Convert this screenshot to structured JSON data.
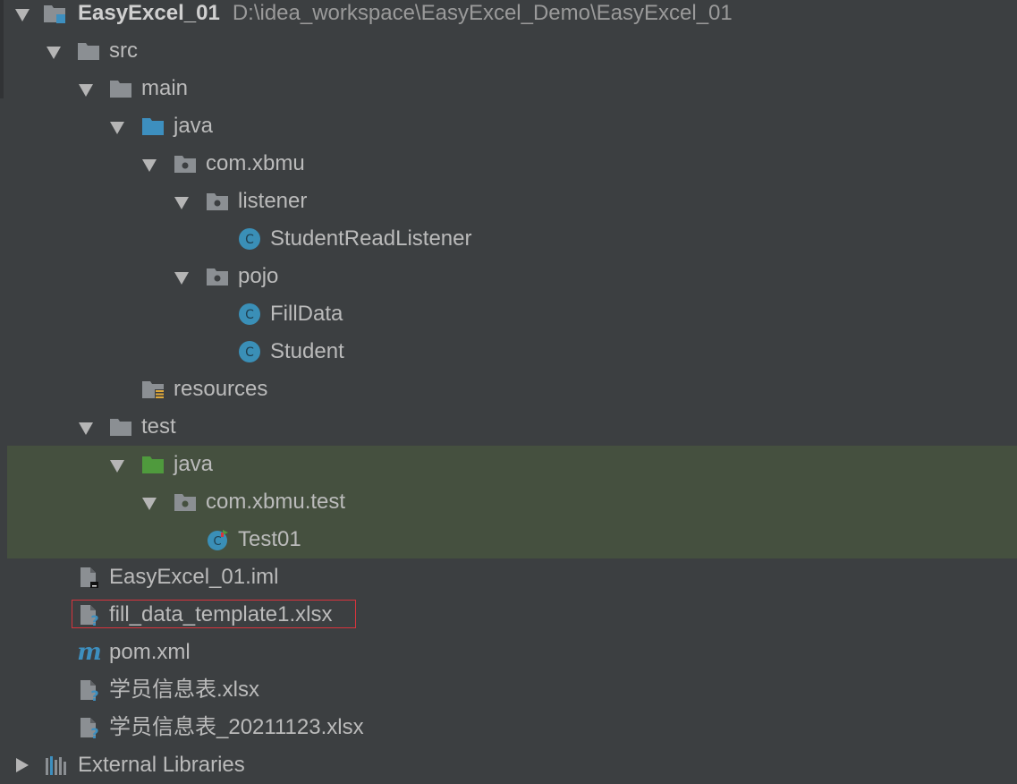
{
  "project": {
    "name": "EasyExcel_01",
    "path": "D:\\idea_workspace\\EasyExcel_Demo\\EasyExcel_01"
  },
  "tree": {
    "src": "src",
    "main": "main",
    "main_java": "java",
    "pkg_main": "com.xbmu",
    "listener": "listener",
    "student_read_listener": "StudentReadListener",
    "pojo": "pojo",
    "fill_data": "FillData",
    "student": "Student",
    "resources": "resources",
    "test": "test",
    "test_java": "java",
    "pkg_test": "com.xbmu.test",
    "test01": "Test01",
    "iml": "EasyExcel_01.iml",
    "fill_template": "fill_data_template1.xlsx",
    "pom": "pom.xml",
    "xlsx1": "学员信息表.xlsx",
    "xlsx2": "学员信息表_20211123.xlsx",
    "external_libraries": "External Libraries"
  },
  "colors": {
    "background": "#3c3f41",
    "highlight_row": "#45503f",
    "selection_border": "#d8343d",
    "folder": "#8b8f93",
    "source_folder": "#3d8fbf",
    "test_folder": "#4f9a3d",
    "class_icon": "#3a8fb7"
  }
}
